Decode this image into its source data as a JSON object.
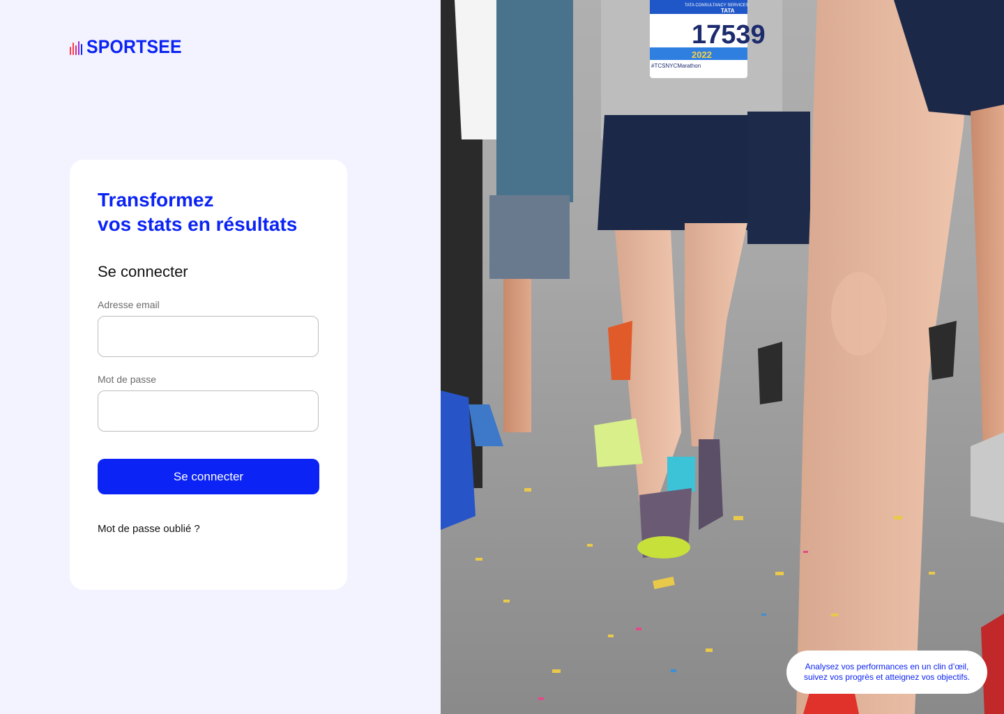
{
  "brand": {
    "name": "SPORTSEE",
    "logo_icon": "bar-pulse-logo",
    "color": "#0b23f4"
  },
  "hero": {
    "line1": "Transformez",
    "line2": "vos stats en résultats"
  },
  "login": {
    "title": "Se connecter",
    "email_label": "Adresse email",
    "email_value": "",
    "password_label": "Mot de passe",
    "password_value": "",
    "submit_label": "Se connecter",
    "forgot_label": "Mot de passe oublié ?"
  },
  "photo": {
    "description_icon": "marathon-runners-photo",
    "bib_number": "17539",
    "bib_year": "2022",
    "bib_hashtag": "#TCSNYCMarathon",
    "bib_sponsor": "TATA CONSULTANCY SERVICES",
    "bib_brand": "TATA"
  },
  "caption": {
    "line1": "Analysez vos performances en un clin d’œil,",
    "line2": "suivez vos progrès et atteignez vos objectifs."
  },
  "colors": {
    "accent": "#0b23f4",
    "page_bg": "#f2f3ff",
    "card_bg": "#ffffff"
  }
}
